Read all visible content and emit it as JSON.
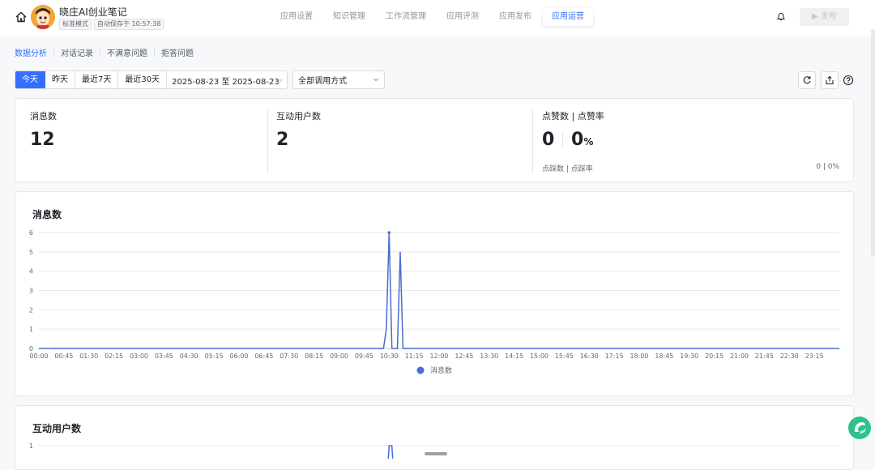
{
  "header": {
    "app_title": "晓庄AI创业笔记",
    "mode_badge": "标准模式",
    "autosave_badge": "自动保存于 10:57:38",
    "tabs": [
      {
        "label": "应用设置"
      },
      {
        "label": "知识管理"
      },
      {
        "label": "工作流管理"
      },
      {
        "label": "应用评测"
      },
      {
        "label": "应用发布"
      },
      {
        "label": "应用运营",
        "active": true
      }
    ],
    "publish_label": "发布"
  },
  "subnav": {
    "items": [
      {
        "label": "数据分析",
        "active": true
      },
      {
        "label": "对话记录"
      },
      {
        "label": "不满意问题"
      },
      {
        "label": "拒答问题"
      }
    ]
  },
  "filters": {
    "ranges": [
      {
        "label": "今天",
        "active": true
      },
      {
        "label": "昨天"
      },
      {
        "label": "最近7天"
      },
      {
        "label": "最近30天"
      }
    ],
    "date_range": "2025-08-23 至 2025-08-23",
    "call_mode": "全部调用方式"
  },
  "stats": {
    "messages": {
      "label": "消息数",
      "value": "12"
    },
    "users": {
      "label": "互动用户数",
      "value": "2"
    },
    "likes": {
      "label": "点赞数 | 点赞率",
      "count": "0",
      "rate": "0",
      "rate_unit": "%",
      "sub_label": "点踩数 | 点踩率",
      "sub_value": "0 | 0%"
    }
  },
  "charts": {
    "messages_title": "消息数",
    "users_title": "互动用户数"
  },
  "chart_data": [
    {
      "type": "line",
      "title": "消息数",
      "x": [
        "00:00",
        "00:45",
        "01:30",
        "02:15",
        "03:00",
        "03:45",
        "04:30",
        "05:15",
        "06:00",
        "06:45",
        "07:30",
        "08:15",
        "09:00",
        "09:45",
        "10:30",
        "11:15",
        "12:00",
        "12:45",
        "13:30",
        "14:15",
        "15:00",
        "15:45",
        "16:30",
        "17:15",
        "18:00",
        "18:45",
        "19:30",
        "20:15",
        "21:00",
        "21:45",
        "22:30",
        "23:15"
      ],
      "series": [
        {
          "name": "消息数",
          "points": [
            {
              "x": "10:20",
              "y": 0
            },
            {
              "x": "10:25",
              "y": 1
            },
            {
              "x": "10:30",
              "y": 6
            },
            {
              "x": "10:35",
              "y": 0
            },
            {
              "x": "10:45",
              "y": 0
            },
            {
              "x": "10:50",
              "y": 5
            },
            {
              "x": "10:55",
              "y": 0
            }
          ]
        }
      ],
      "ylim": [
        0,
        6
      ],
      "yticks": [
        "0",
        "1",
        "2",
        "3",
        "4",
        "5",
        "6"
      ],
      "legend": "bottom-center",
      "color": "#4a6bd1",
      "grid": true
    },
    {
      "type": "line",
      "title": "互动用户数",
      "series": [
        {
          "name": "互动用户数",
          "points": [
            {
              "x": "10:30",
              "y": 1
            },
            {
              "x": "10:35",
              "y": 1
            }
          ]
        }
      ],
      "yticks": [
        "1"
      ],
      "color": "#4a6bd1"
    }
  ]
}
